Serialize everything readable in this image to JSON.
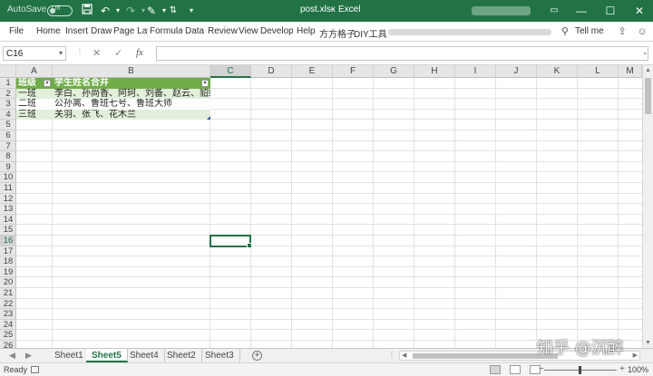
{
  "titlebar": {
    "autosave_label": "AutoSave",
    "autosave_state": "Off",
    "filename": "post.xlsx",
    "separator": "-",
    "app_name": "Excel",
    "color": "#217346"
  },
  "ribbon": {
    "tabs": [
      "File",
      "Home",
      "Insert",
      "Draw",
      "Page Lay",
      "Formula",
      "Data",
      "Review",
      "View",
      "Develop",
      "Help",
      "方方格子",
      "DIY工具"
    ],
    "tell_me": "Tell me"
  },
  "formula_bar": {
    "name_box": "C16",
    "fx": "fx",
    "formula": ""
  },
  "grid": {
    "columns": [
      "A",
      "B",
      "C",
      "D",
      "E",
      "F",
      "G",
      "H",
      "I",
      "J",
      "K",
      "L",
      "M"
    ],
    "selected_column": "C",
    "selected_row": 16,
    "row_count": 26,
    "table": {
      "header": [
        "班级",
        "学生姓名合并"
      ],
      "rows": [
        [
          "一班",
          "李白、孙尚香、阿珂、刘备、赵云、貂蝉"
        ],
        [
          "二班",
          "公孙离、鲁班七号、鲁班大师"
        ],
        [
          "三班",
          "关羽、张飞、花木兰"
        ]
      ],
      "header_color": "#70ad47",
      "band_color": "#e2efda"
    }
  },
  "sheets": {
    "tabs": [
      "Sheet1",
      "Sheet5",
      "Sheet4",
      "Sheet2",
      "Sheet3"
    ],
    "active": "Sheet5",
    "add_label": "+"
  },
  "status": {
    "ready": "Ready",
    "zoom": "100%",
    "minus": "−",
    "plus": "+"
  },
  "watermark": "知乎 @沉醉"
}
